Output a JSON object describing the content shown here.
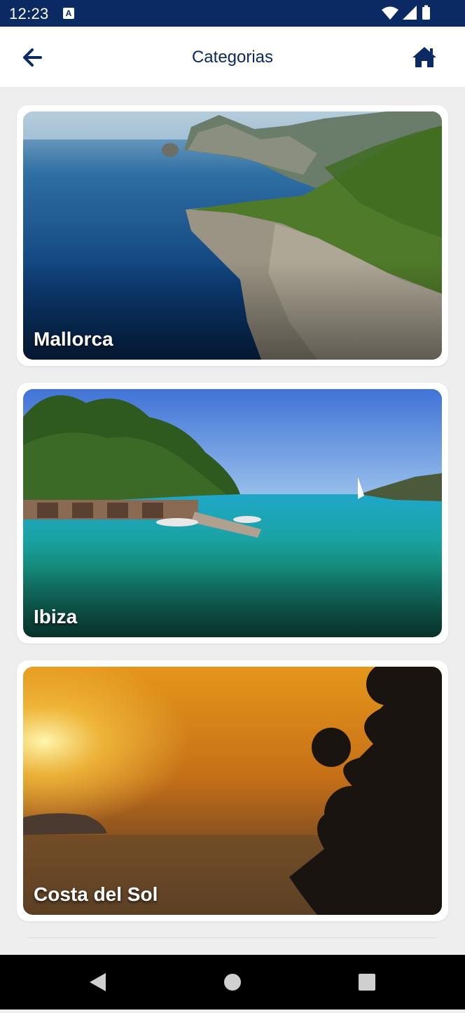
{
  "status_bar": {
    "time": "12:23",
    "notification_badge": "A",
    "icons": [
      "wifi-icon",
      "signal-icon",
      "battery-icon"
    ]
  },
  "app_bar": {
    "title": "Categorias",
    "back_icon": "arrow-left-icon",
    "home_icon": "home-icon"
  },
  "categories": [
    {
      "label": "Mallorca",
      "image": "coastal-cliffs-sea-photo"
    },
    {
      "label": "Ibiza",
      "image": "turquoise-bay-boathouses-photo"
    },
    {
      "label": "Costa del Sol",
      "image": "sunset-palm-silhouette-photo"
    }
  ],
  "nav_bar": {
    "back": "nav-back-icon",
    "home": "nav-home-icon",
    "recents": "nav-recents-icon"
  },
  "colors": {
    "primary": "#0b2a63",
    "background": "#eeeeee",
    "card": "#ffffff"
  }
}
